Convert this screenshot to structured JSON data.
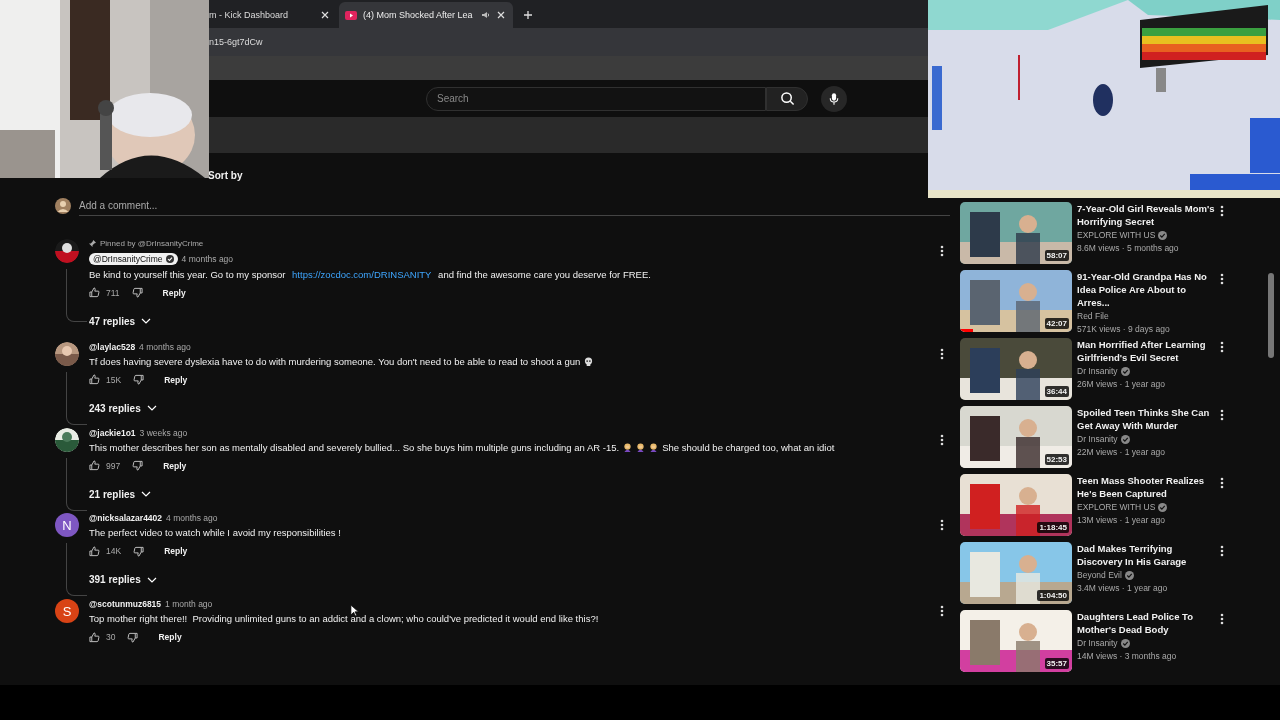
{
  "tabs": [
    {
      "label": "m - Kick Dashboard",
      "selected": false,
      "audio": false,
      "favicon": false
    },
    {
      "label": "(4) Mom Shocked After Lea",
      "selected": true,
      "audio": true,
      "favicon": true
    }
  ],
  "address": "n15-6gt7dCw",
  "search": {
    "placeholder": "Search"
  },
  "sort_label": "Sort by",
  "add_comment": {
    "placeholder": "Add a comment..."
  },
  "comments": [
    {
      "avatar": {
        "kind": "picture"
      },
      "pinned": "Pinned by @DrInsanityCrime",
      "author": "@DrInsanityCrime",
      "owner": true,
      "time": "4 months ago",
      "segments": [
        {
          "kind": "text",
          "text": "Be kind to yourself this year. Go to my sponsor "
        },
        {
          "kind": "link",
          "text": "https://zocdoc.com/DRINSANITY"
        },
        {
          "kind": "text",
          "text": " and find the awesome care you deserve for FREE."
        }
      ],
      "likes": "711",
      "reply": "Reply",
      "replies": "47 replies"
    },
    {
      "avatar": {
        "kind": "picture"
      },
      "author": "@laylac528",
      "owner": false,
      "time": "4 months ago",
      "segments": [
        {
          "kind": "text",
          "text": "Tf does having severe dyslexia have to do with murdering someone. You don't need to be able to read to shoot a gun"
        },
        {
          "kind": "skull"
        }
      ],
      "likes": "15K",
      "reply": "Reply",
      "replies": "243 replies"
    },
    {
      "avatar": {
        "kind": "picture"
      },
      "author": "@jackie1o1",
      "owner": false,
      "time": "3 weeks ago",
      "segments": [
        {
          "kind": "text",
          "text": "This mother describes her son as mentally disabled and severely bullied... So she buys him multiple guns including an AR -15."
        },
        {
          "kind": "facepalm"
        },
        {
          "kind": "facepalm"
        },
        {
          "kind": "facepalm"
        },
        {
          "kind": "text",
          "text": "She should be charged too, what an idiot"
        }
      ],
      "likes": "997",
      "reply": "Reply",
      "replies": "21 replies"
    },
    {
      "avatar": {
        "kind": "letter",
        "letter": "N",
        "color": "#7e57c2"
      },
      "author": "@nicksalazar4402",
      "owner": false,
      "time": "4 months ago",
      "segments": [
        {
          "kind": "text",
          "text": "The perfect video to watch while I avoid my responsibilities !"
        }
      ],
      "likes": "14K",
      "reply": "Reply",
      "replies": "391 replies"
    },
    {
      "avatar": {
        "kind": "letter",
        "letter": "S",
        "color": "#d84315"
      },
      "author": "@scotunmuz6815",
      "owner": false,
      "time": "1 month ago",
      "segments": [
        {
          "kind": "text",
          "text": "Top mother right there!!  Providing unlimited guns to an addict and a clown; who could've predicted it would end like this?!"
        }
      ],
      "likes": "30",
      "reply": "Reply"
    }
  ],
  "recommendations": [
    {
      "title": "7-Year-Old Girl Reveals Mom's Horrifying Secret",
      "channel": "EXPLORE WITH US",
      "verified": true,
      "meta": "8.6M views · 5 months ago",
      "duration": "58:07",
      "watched": false
    },
    {
      "title": "91-Year-Old Grandpa Has No Idea Police Are About to Arres...",
      "channel": "Red File",
      "verified": false,
      "meta": "571K views · 9 days ago",
      "duration": "42:07",
      "watched": true
    },
    {
      "title": "Man Horrified After Learning Girlfriend's Evil Secret",
      "channel": "Dr Insanity",
      "verified": true,
      "meta": "26M views · 1 year ago",
      "duration": "36:44",
      "watched": false
    },
    {
      "title": "Spoiled Teen Thinks She Can Get Away With Murder",
      "channel": "Dr Insanity",
      "verified": true,
      "meta": "22M views · 1 year ago",
      "duration": "52:53",
      "watched": false
    },
    {
      "title": "Teen Mass Shooter Realizes He's Been Captured",
      "channel": "EXPLORE WITH US",
      "verified": true,
      "meta": "13M views · 1 year ago",
      "duration": "1:18:45",
      "watched": false
    },
    {
      "title": "Dad Makes Terrifying Discovery In His Garage",
      "channel": "Beyond Evil",
      "verified": true,
      "meta": "3.4M views · 1 year ago",
      "duration": "1:04:50",
      "watched": false
    },
    {
      "title": "Daughters Lead Police To Mother's Dead Body",
      "channel": "Dr Insanity",
      "verified": true,
      "meta": "14M views · 3 months ago",
      "duration": "35:57",
      "watched": false
    }
  ],
  "webcam": {
    "kind": "picture"
  },
  "game_overlay": {
    "kind": "picture"
  }
}
